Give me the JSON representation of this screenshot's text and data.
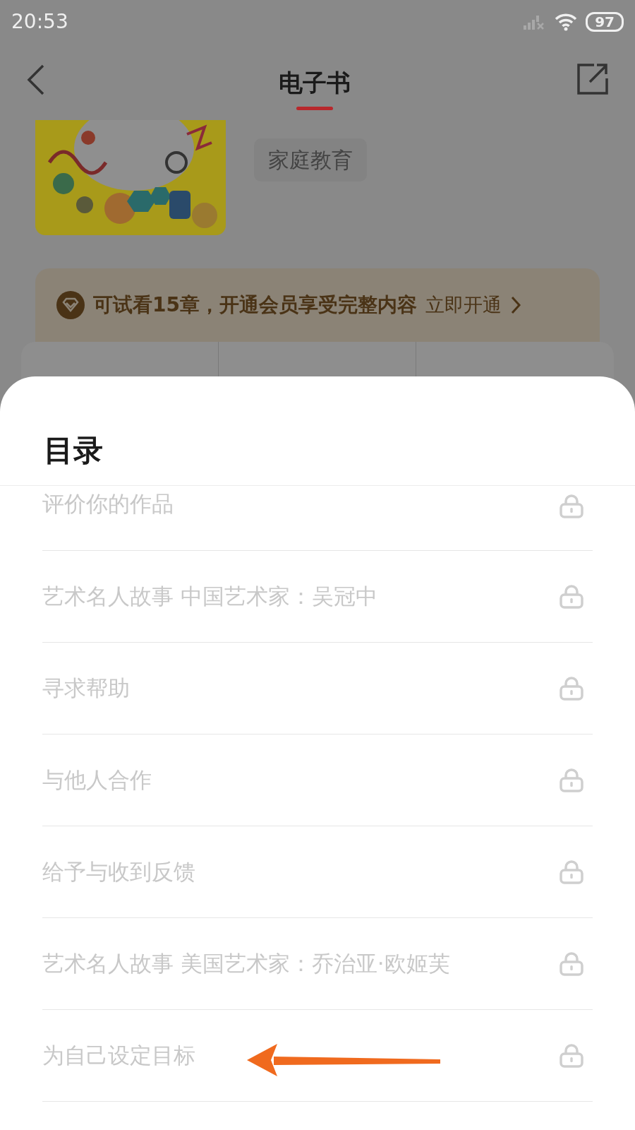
{
  "status_bar": {
    "time": "20:53",
    "battery": "97"
  },
  "header": {
    "title": "电子书"
  },
  "book": {
    "tag": "家庭教育"
  },
  "banner": {
    "text": "可试看15章，开通会员享受完整内容",
    "action": "立即开通"
  },
  "sheet": {
    "title": "目录",
    "chapters": [
      {
        "title": "评价你的作品",
        "locked": true
      },
      {
        "title": "艺术名人故事 中国艺术家：吴冠中",
        "locked": true
      },
      {
        "title": "寻求帮助",
        "locked": true
      },
      {
        "title": "与他人合作",
        "locked": true
      },
      {
        "title": "给予与收到反馈",
        "locked": true
      },
      {
        "title": "艺术名人故事 美国艺术家：乔治亚·欧姬芙",
        "locked": true
      },
      {
        "title": "为自己设定目标",
        "locked": true
      }
    ]
  }
}
